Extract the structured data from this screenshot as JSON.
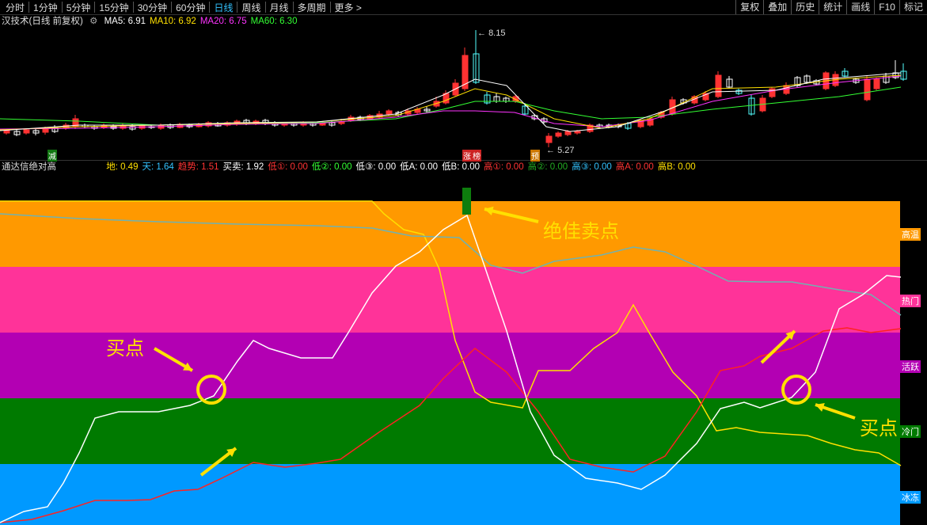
{
  "toolbar": {
    "periods": [
      "分时",
      "1分钟",
      "5分钟",
      "15分钟",
      "30分钟",
      "60分钟",
      "日线",
      "周线",
      "月线",
      "多周期",
      "更多 >"
    ],
    "active_period": "日线",
    "right_tools": [
      "复权",
      "叠加",
      "历史",
      "统计",
      "画线",
      "F10",
      "标记"
    ]
  },
  "price_panel": {
    "title": "汉技术(日线 前复权)",
    "ma": [
      {
        "label": "MA5: 6.91",
        "color": "#ffffff"
      },
      {
        "label": "MA10: 6.92",
        "color": "#ffe000"
      },
      {
        "label": "MA20: 6.75",
        "color": "#ff33ff"
      },
      {
        "label": "MA60: 6.30",
        "color": "#33ff33"
      }
    ],
    "high_marker": "8.15",
    "low_marker": "5.27",
    "tags": {
      "jian": "减",
      "zhang": "涨",
      "bang": "榜",
      "yu": "预"
    }
  },
  "indicator_panel": {
    "title": "通达信绝对高",
    "values": [
      {
        "label": "地: 0.49",
        "color": "#ffe000"
      },
      {
        "label": "天: 1.64",
        "color": "#33c3ff"
      },
      {
        "label": "趋势: 1.51",
        "color": "#ff3333"
      },
      {
        "label": "买卖: 1.92",
        "color": "#ffffff"
      },
      {
        "label": "低①: 0.00",
        "color": "#ff3333"
      },
      {
        "label": "低②: 0.00",
        "color": "#33ff33"
      },
      {
        "label": "低③: 0.00",
        "color": "#ffffff"
      },
      {
        "label": "低A: 0.00",
        "color": "#ffffff"
      },
      {
        "label": "低B: 0.00",
        "color": "#ffffff"
      },
      {
        "label": "高①: 0.00",
        "color": "#ff3333"
      },
      {
        "label": "高②: 0.00",
        "color": "#22aa22"
      },
      {
        "label": "高③: 0.00",
        "color": "#33c3ff"
      },
      {
        "label": "高A: 0.00",
        "color": "#ff3333"
      },
      {
        "label": "高B: 0.00",
        "color": "#ffe000"
      }
    ],
    "zones": [
      {
        "label": "高温",
        "color": "#ff9900"
      },
      {
        "label": "热门",
        "color": "#ff3399"
      },
      {
        "label": "活跃",
        "color": "#b300b3"
      },
      {
        "label": "冷门",
        "color": "#007a00"
      },
      {
        "label": "冰冻",
        "color": "#0099ff"
      }
    ],
    "annotations": {
      "sell": "绝佳卖点",
      "buy_left": "买点",
      "buy_right": "买点"
    }
  }
}
